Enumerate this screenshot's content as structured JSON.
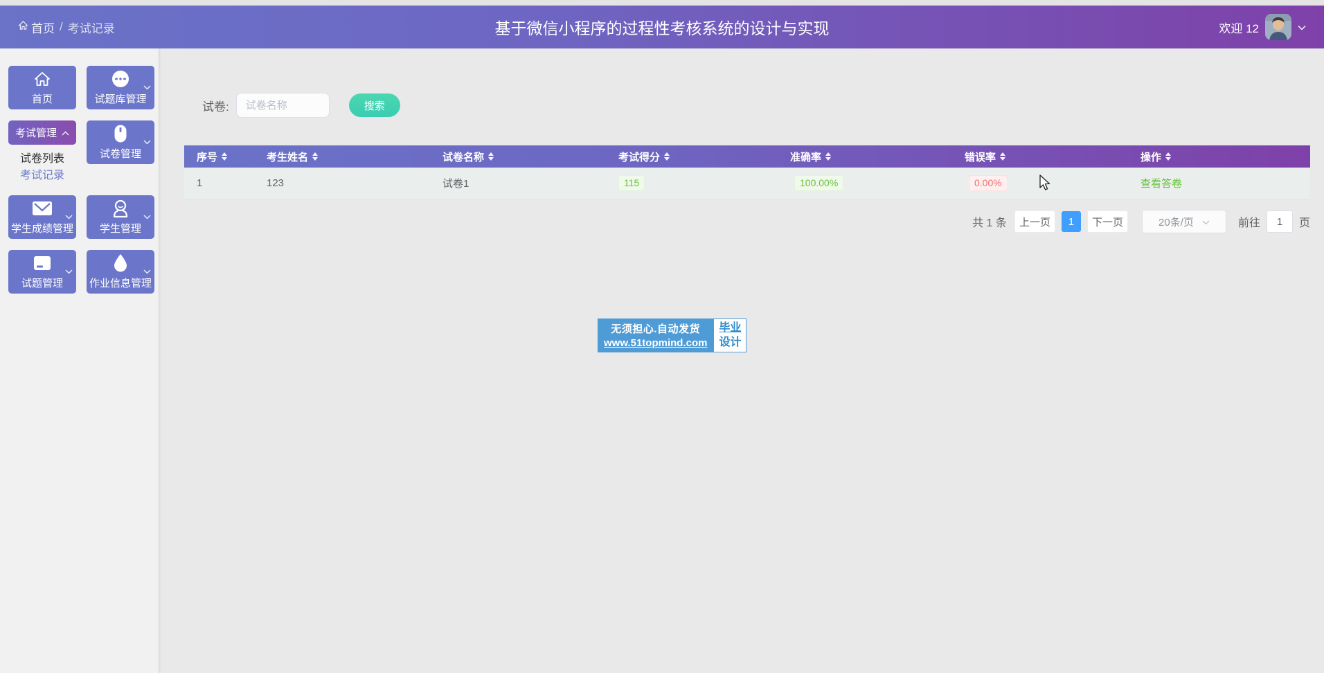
{
  "header": {
    "breadcrumb": {
      "home_label": "首页",
      "separator": "/",
      "current": "考试记录"
    },
    "title": "基于微信小程序的过程性考核系统的设计与实现",
    "welcome_text": "欢迎 12"
  },
  "sidebar": {
    "tiles": [
      {
        "label": "首页",
        "icon": "home-icon",
        "chevron": "none"
      },
      {
        "label": "试题库管理",
        "icon": "question-bank-icon",
        "chevron": "down"
      },
      {
        "label": "考试管理",
        "icon": "none",
        "chevron": "up",
        "expanded": true
      },
      {
        "label": "试卷管理",
        "icon": "mouse-icon",
        "chevron": "down"
      },
      {
        "label": "学生成绩管理",
        "icon": "mail-icon",
        "chevron": "down"
      },
      {
        "label": "学生管理",
        "icon": "user-icon",
        "chevron": "down"
      },
      {
        "label": "试题管理",
        "icon": "card-icon",
        "chevron": "down"
      },
      {
        "label": "作业信息管理",
        "icon": "drop-icon",
        "chevron": "down"
      }
    ],
    "exam_submenu": [
      {
        "label": "试卷列表",
        "active": false
      },
      {
        "label": "考试记录",
        "active": true
      }
    ]
  },
  "search": {
    "label": "试卷:",
    "placeholder": "试卷名称",
    "button_label": "搜索"
  },
  "table": {
    "columns": [
      "序号",
      "考生姓名",
      "试卷名称",
      "考试得分",
      "准确率",
      "错误率",
      "操作"
    ],
    "rows": [
      {
        "seq": "1",
        "student_name": "123",
        "paper_name": "试卷1",
        "score": "115",
        "accuracy": "100.00%",
        "error_rate": "0.00%",
        "action": "查看答卷"
      }
    ]
  },
  "pagination": {
    "total": "共 1 条",
    "prev": "上一页",
    "current_page": "1",
    "next": "下一页",
    "page_size": "20条/页",
    "goto_label": "前往",
    "goto_value": "1",
    "goto_unit": "页"
  },
  "watermark": {
    "line1": "无须担心.自动发货",
    "line2": "www.51topmind.com",
    "badge_top": "毕业",
    "badge_bottom": "设计"
  },
  "colors": {
    "header_gradient_start": "#6a73c8",
    "header_gradient_end": "#7e41a9",
    "tile": "#6b76ca",
    "search_button": "#41cfae",
    "pagination_active": "#409eff",
    "success": "#67c23a",
    "danger": "#f56c6c",
    "watermark_blue": "#4f9bd6"
  }
}
